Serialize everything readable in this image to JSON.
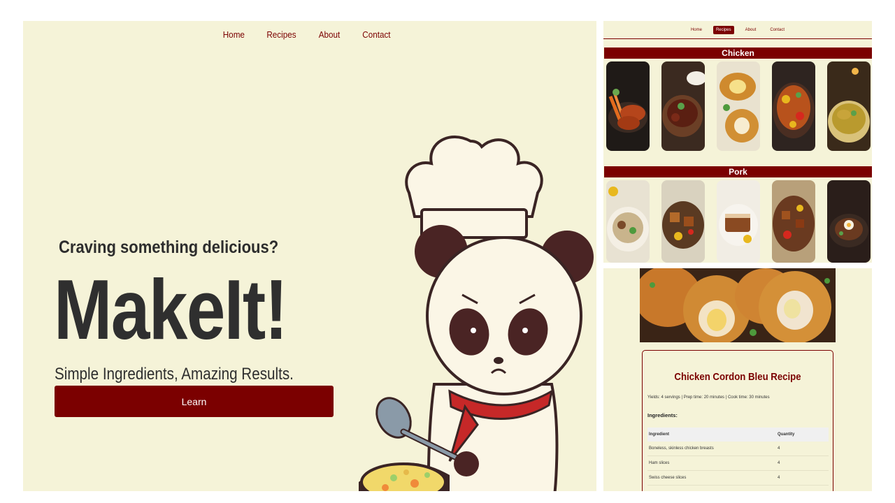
{
  "main": {
    "nav": [
      "Home",
      "Recipes",
      "About",
      "Contact"
    ],
    "tagline": "Craving something delicious?",
    "brand": "MakeIt!",
    "subtitle": "Simple Ingredients, Amazing Results.",
    "cta_label": "Learn",
    "colors": {
      "background": "#f5f3d8",
      "accent": "#7b0000",
      "text": "#2f2f2f"
    }
  },
  "recipes_preview": {
    "nav": [
      "Home",
      "Recipes",
      "About",
      "Contact"
    ],
    "active_nav": "Recipes",
    "categories": [
      {
        "title": "Chicken",
        "item_count": 5
      },
      {
        "title": "Pork",
        "item_count": 5
      }
    ]
  },
  "recipe_detail": {
    "title": "Chicken Cordon Bleu Recipe",
    "meta": "Yields: 4 servings | Prep time: 20 minutes | Cook time: 30 minutes",
    "ingredients_heading": "Ingredients:",
    "table": {
      "headers": [
        "Ingredient",
        "Quantity"
      ],
      "rows": [
        [
          "Boneless, skinless chicken breasts",
          "4"
        ],
        [
          "Ham slices",
          "4"
        ],
        [
          "Swiss cheese slices",
          "4"
        ]
      ]
    }
  }
}
